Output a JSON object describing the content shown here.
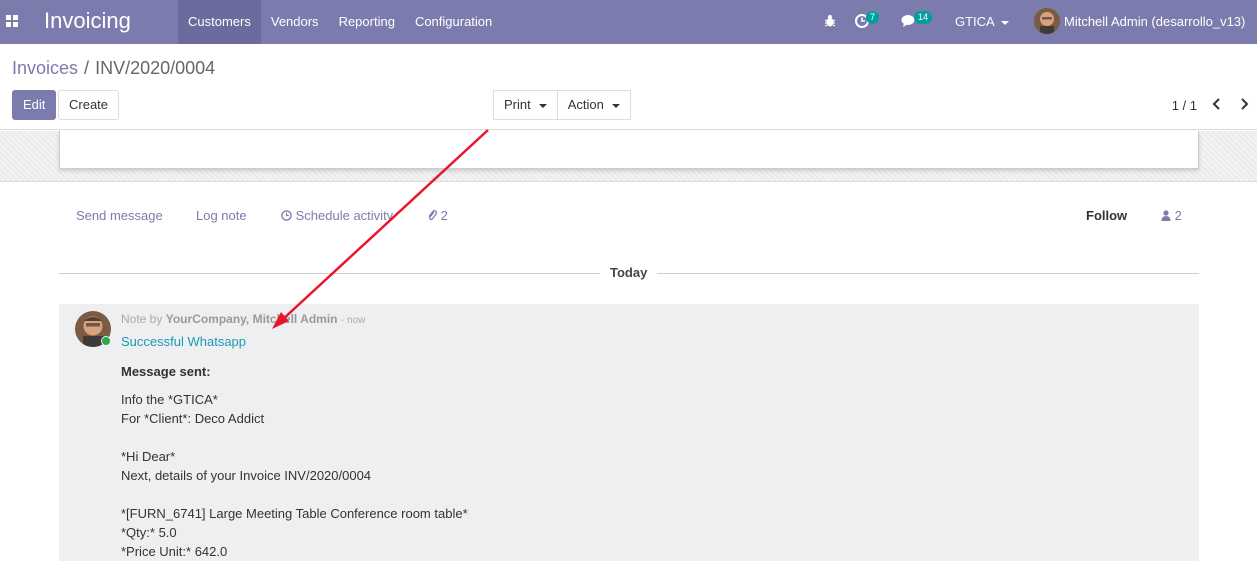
{
  "navbar": {
    "brand": "Invoicing",
    "menu": [
      "Customers",
      "Vendors",
      "Reporting",
      "Configuration"
    ],
    "activities_count": "7",
    "messages_count": "14",
    "company": "GTICA",
    "user": "Mitchell Admin (desarrollo_v13)"
  },
  "breadcrumb": {
    "parent": "Invoices",
    "separator": "/",
    "current": "INV/2020/0004"
  },
  "buttons": {
    "edit": "Edit",
    "create": "Create",
    "print": "Print",
    "action": "Action"
  },
  "pager": {
    "value": "1 / 1"
  },
  "chatter": {
    "send_message": "Send message",
    "log_note": "Log note",
    "schedule_activity": "Schedule activity",
    "attachments_count": "2",
    "follow": "Follow",
    "followers_count": "2"
  },
  "divider": {
    "label": "Today"
  },
  "message": {
    "prefix": "Note by",
    "author": "YourCompany, Mitchell Admin",
    "time": "- now",
    "subject": "Successful Whatsapp",
    "heading": "Message sent:",
    "lines": [
      "Info the *GTICA*",
      "For *Client*: Deco Addict",
      "",
      "*Hi Dear*",
      "Next, details of your Invoice INV/2020/0004",
      "",
      "*[FURN_6741] Large Meeting Table Conference room table*",
      "*Qty:* 5.0",
      "*Price Unit:* 642.0"
    ]
  },
  "colors": {
    "navbar": "#7c7bad",
    "badge": "#00a09d",
    "subject": "#1b9ab5",
    "arrow": "#e8162c"
  }
}
